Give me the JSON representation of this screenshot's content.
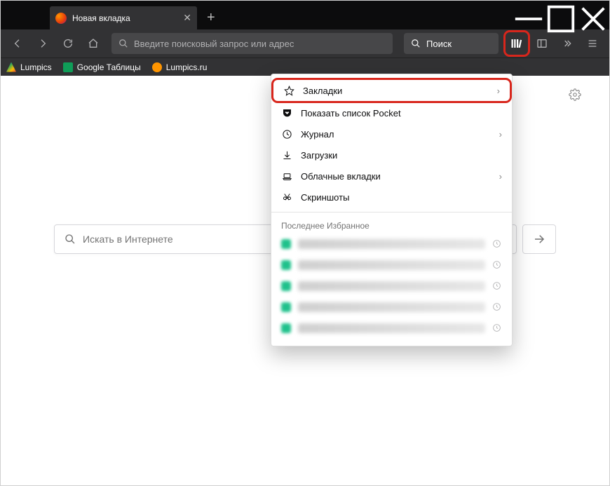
{
  "tab": {
    "title": "Новая вкладка"
  },
  "navbar": {
    "url_placeholder": "Введите поисковый запрос или адрес",
    "search_placeholder": "Поиск"
  },
  "bookmarks_toolbar": {
    "items": [
      {
        "label": "Lumpics"
      },
      {
        "label": "Google Таблицы"
      },
      {
        "label": "Lumpics.ru"
      }
    ]
  },
  "content": {
    "search_placeholder": "Искать в Интернете"
  },
  "library_menu": {
    "items": [
      {
        "label": "Закладки",
        "icon": "star-icon",
        "has_submenu": true,
        "highlighted": true
      },
      {
        "label": "Показать список Pocket",
        "icon": "pocket-icon",
        "has_submenu": false
      },
      {
        "label": "Журнал",
        "icon": "history-icon",
        "has_submenu": true
      },
      {
        "label": "Загрузки",
        "icon": "downloads-icon",
        "has_submenu": false
      },
      {
        "label": "Облачные вкладки",
        "icon": "synced-tabs-icon",
        "has_submenu": true
      },
      {
        "label": "Скриншоты",
        "icon": "screenshots-icon",
        "has_submenu": false
      }
    ],
    "recent_title": "Последнее Избранное",
    "recent_count": 5
  }
}
